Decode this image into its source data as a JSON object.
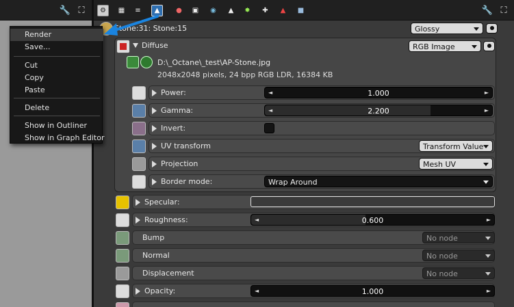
{
  "breadcrumb": "Stone:31: Stone:15",
  "material_type": "Glossy",
  "diffuse": {
    "label": "Diffuse",
    "type": "RGB Image",
    "file_path": "D:\\_Octane\\_test\\AP-Stone.jpg",
    "file_info": "2048x2048 pixels, 24 bpp RGB LDR, 16384 KB",
    "rows": [
      {
        "label": "Power:",
        "value": "1.000"
      },
      {
        "label": "Gamma:",
        "value": "2.200",
        "fill": 0.73
      },
      {
        "label": "Invert:"
      },
      {
        "label": "UV transform",
        "value": "Transform Value"
      },
      {
        "label": "Projection",
        "value": "Mesh UV"
      },
      {
        "label": "Border mode:",
        "value": "Wrap Around"
      }
    ]
  },
  "params": [
    {
      "label": "Specular:"
    },
    {
      "label": "Roughness:",
      "value": "0.600",
      "fill": 0.47
    },
    {
      "label": "Bump",
      "value": "No node"
    },
    {
      "label": "Normal",
      "value": "No node"
    },
    {
      "label": "Displacement",
      "value": "No node"
    },
    {
      "label": "Opacity:",
      "value": "1.000"
    }
  ],
  "context_menu": {
    "items": [
      "Render",
      "Save...",
      "Cut",
      "Copy",
      "Paste",
      "Delete",
      "Show in Outliner",
      "Show in Graph Editor"
    ]
  },
  "arrows": {
    "left": "◄",
    "right": "►"
  },
  "colors": {
    "accent_arrow": "#1a84e0",
    "panel_bg": "#3a3a3a",
    "left_panel_bg": "#9a9a9a"
  },
  "icons": [
    "wrench-icon",
    "fullscreen-icon",
    "render-icon",
    "material-icon",
    "texture-icon",
    "camera-icon",
    "world-icon",
    "image-icon",
    "light-icon",
    "toggle-icon",
    "ray-icon",
    "cube-icon"
  ]
}
